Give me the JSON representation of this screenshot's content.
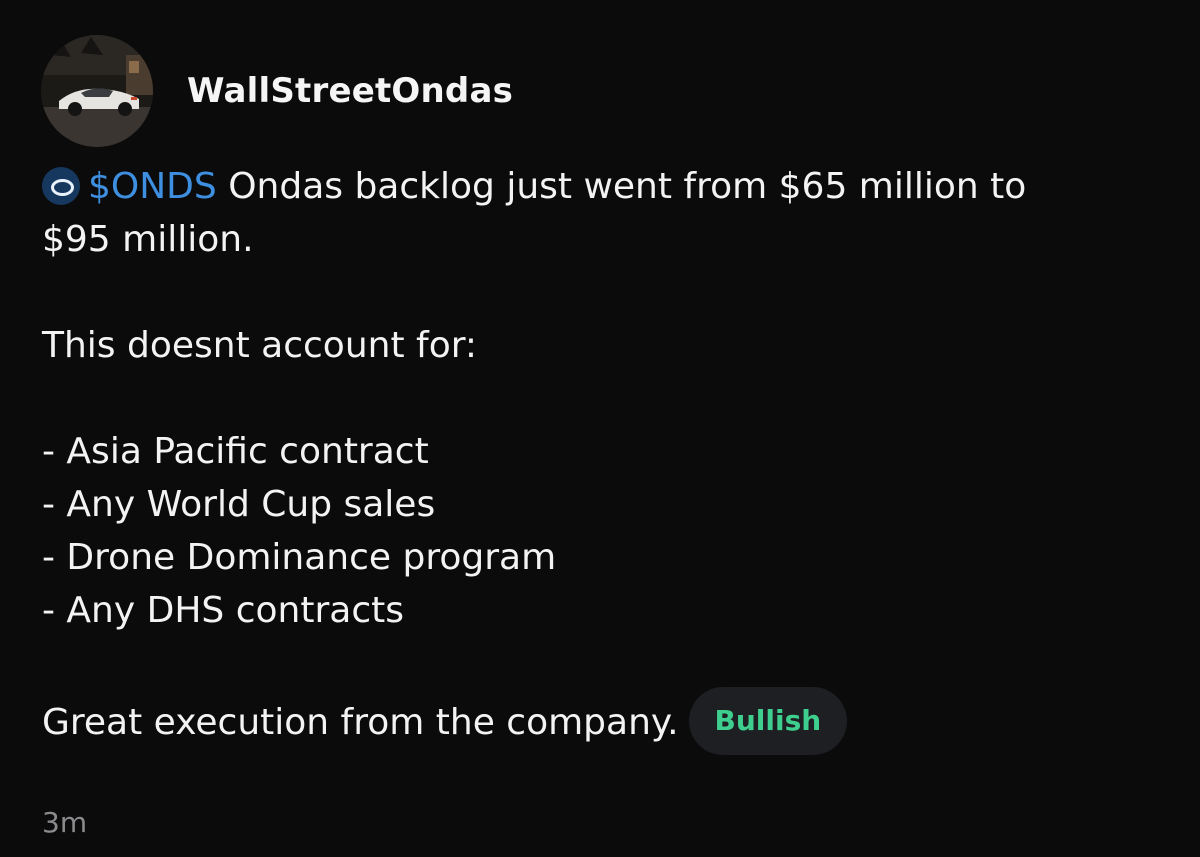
{
  "post": {
    "username": "WallStreetOndas",
    "ticker": "$ONDS",
    "ticker_icon": "ondas-ring-icon",
    "line1_rest": " Ondas backlog just went from $65 million to",
    "line2": "$95 million.",
    "line3": "This doesnt account for:",
    "bullets": [
      "- Asia Pacific contract",
      "- Any World Cup sales",
      "- Drone Dominance program",
      "- Any DHS contracts"
    ],
    "closing": "Great execution from the company.",
    "sentiment_label": "Bullish",
    "timestamp": "3m"
  },
  "colors": {
    "background": "#0b0b0c",
    "ticker": "#3f8fe0",
    "sentiment": "#3ecf8e",
    "timestamp": "#8b8b8e"
  }
}
